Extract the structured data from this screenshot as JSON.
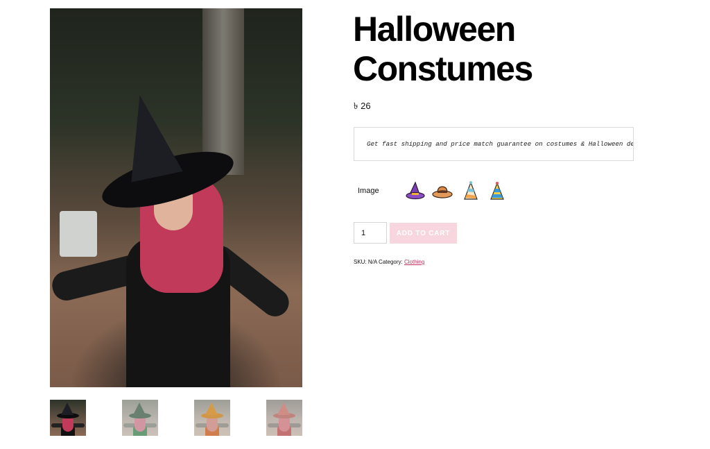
{
  "product": {
    "title": "Halloween Constumes",
    "price": "৳ 26",
    "promo_text": "Get fast shipping and price match guarantee on costumes & Halloween decorations. Br",
    "attribute_label": "Image",
    "swatches": [
      {
        "name": "witch-hat-purple-icon"
      },
      {
        "name": "brown-hat-icon"
      },
      {
        "name": "party-hat-striped-icon"
      },
      {
        "name": "party-hat-blue-icon"
      }
    ],
    "quantity": "1",
    "add_to_cart_label": "ADD TO CART",
    "sku_label": "SKU:",
    "sku_value": "N/A",
    "category_label": "Category:",
    "category_value": "Clothing"
  },
  "colors": {
    "accent": "#c1335a",
    "button_disabled": "#f7d6dd",
    "border": "#d9d9d9"
  }
}
